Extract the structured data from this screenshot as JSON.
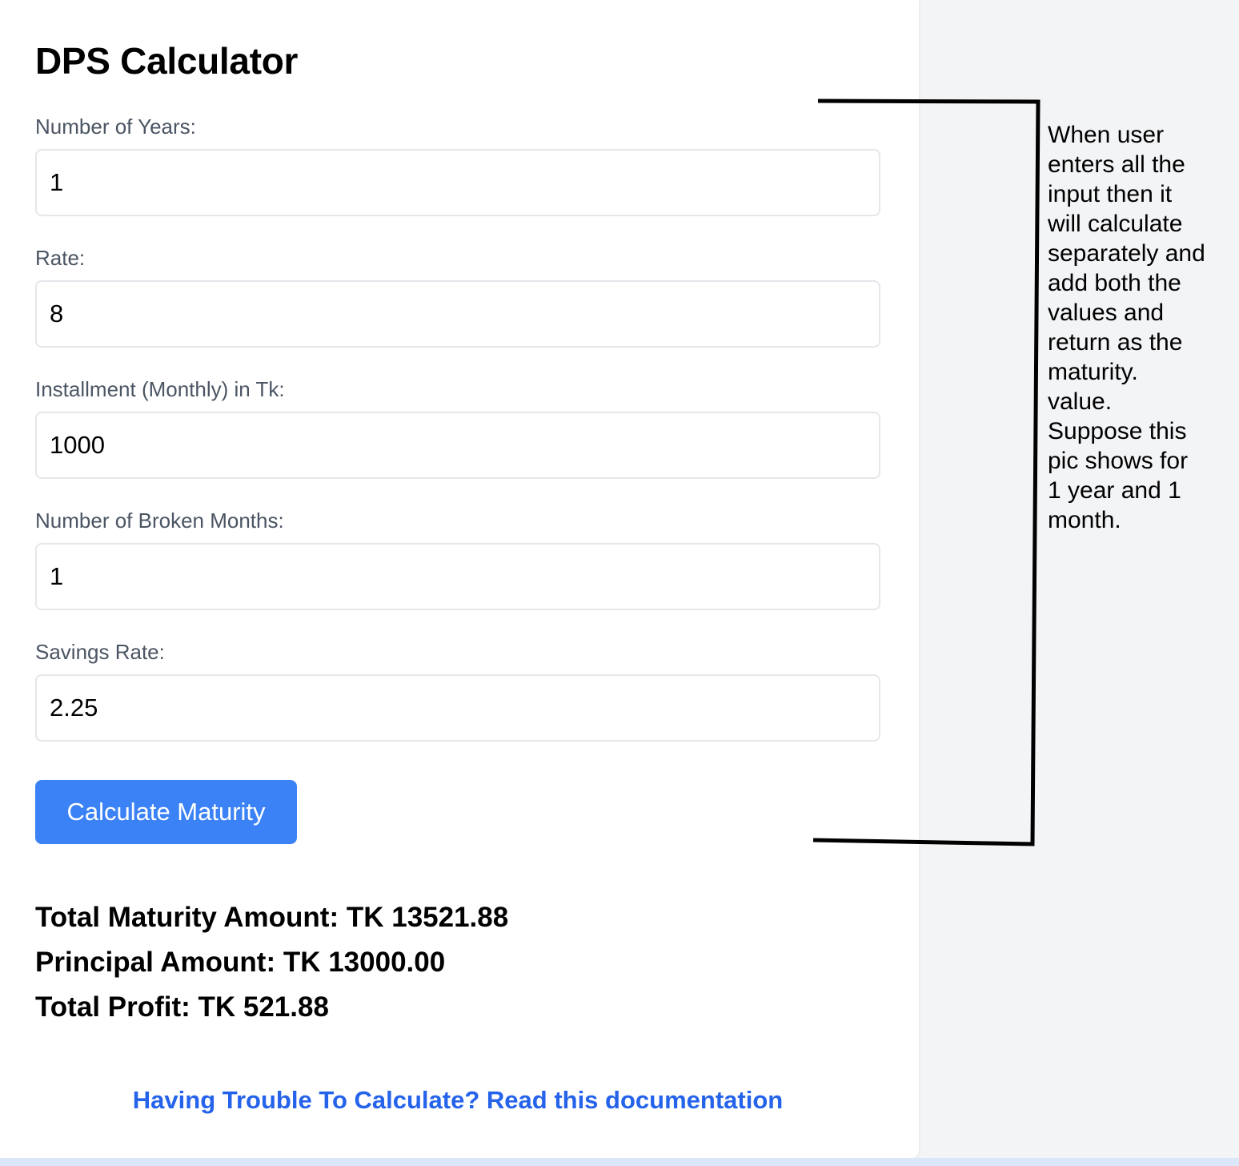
{
  "page": {
    "title": "DPS Calculator"
  },
  "form": {
    "fields": [
      {
        "label": "Number of Years:",
        "value": "1"
      },
      {
        "label": "Rate:",
        "value": "8"
      },
      {
        "label": "Installment (Monthly) in Tk:",
        "value": "1000"
      },
      {
        "label": "Number of Broken Months:",
        "value": "1"
      },
      {
        "label": "Savings Rate:",
        "value": "2.25"
      }
    ],
    "submit_label": "Calculate Maturity"
  },
  "results": {
    "total_maturity": "Total Maturity Amount: TK 13521.88",
    "principal": "Principal Amount: TK 13000.00",
    "total_profit": "Total Profit: TK 521.88"
  },
  "help_link": "Having Trouble To Calculate? Read this documentation",
  "annotation": {
    "lines": [
      "When user",
      "enters all the",
      "input then it",
      "will calculate",
      "separately and",
      "add both the",
      "values and",
      "return as the",
      "maturity.",
      "value.",
      "Suppose this",
      "pic shows for",
      "1 year and 1",
      "month."
    ]
  },
  "colors": {
    "primary_button": "#3b82f6",
    "link": "#2563eb",
    "label": "#4b5563",
    "page_background": "#f3f4f6"
  }
}
